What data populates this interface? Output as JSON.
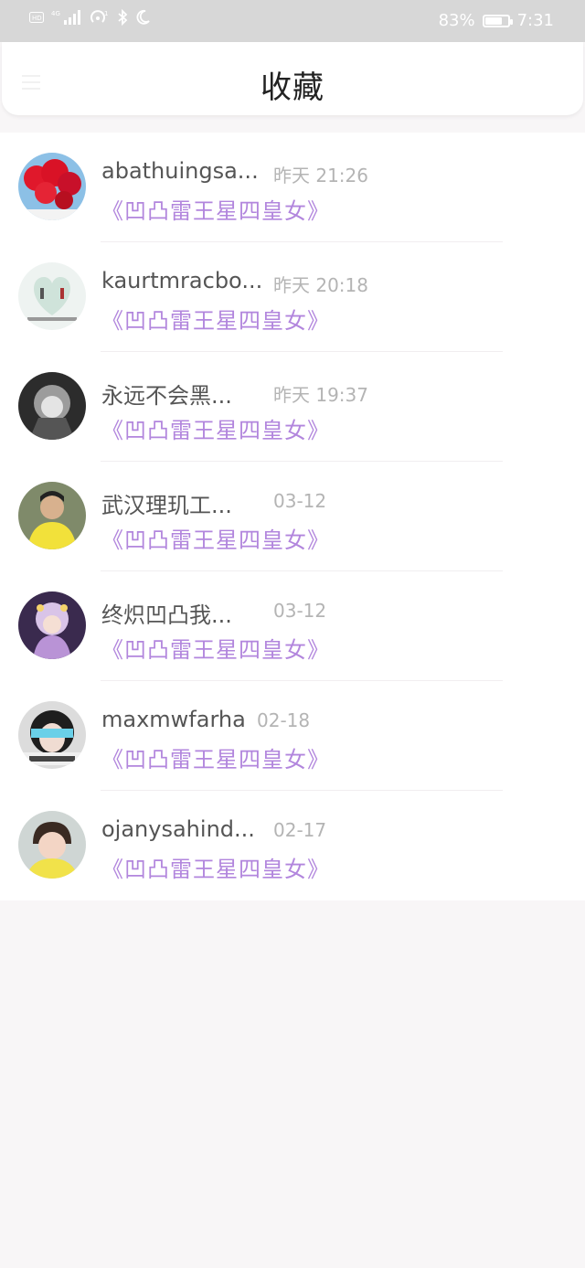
{
  "status_bar": {
    "battery_text": "83%",
    "time": "7:31",
    "battery_level": 0.83
  },
  "header": {
    "title": "收藏"
  },
  "favorites": [
    {
      "user": "abathuingsa...",
      "time": "昨天 21:26",
      "book": "《凹凸雷王星四皇女》"
    },
    {
      "user": "kaurtmracbo...",
      "time": "昨天 20:18",
      "book": "《凹凸雷王星四皇女》"
    },
    {
      "user": "永远不会黑...",
      "time": "昨天 19:37",
      "book": "《凹凸雷王星四皇女》"
    },
    {
      "user": "武汉理玑工...",
      "time": "03-12",
      "book": "《凹凸雷王星四皇女》"
    },
    {
      "user": "终炽凹凸我...",
      "time": "03-12",
      "book": "《凹凸雷王星四皇女》"
    },
    {
      "user": "maxmwfarha",
      "time": "02-18",
      "book": "《凹凸雷王星四皇女》"
    },
    {
      "user": "ojanysahind...",
      "time": "02-17",
      "book": "《凹凸雷王星四皇女》"
    }
  ]
}
